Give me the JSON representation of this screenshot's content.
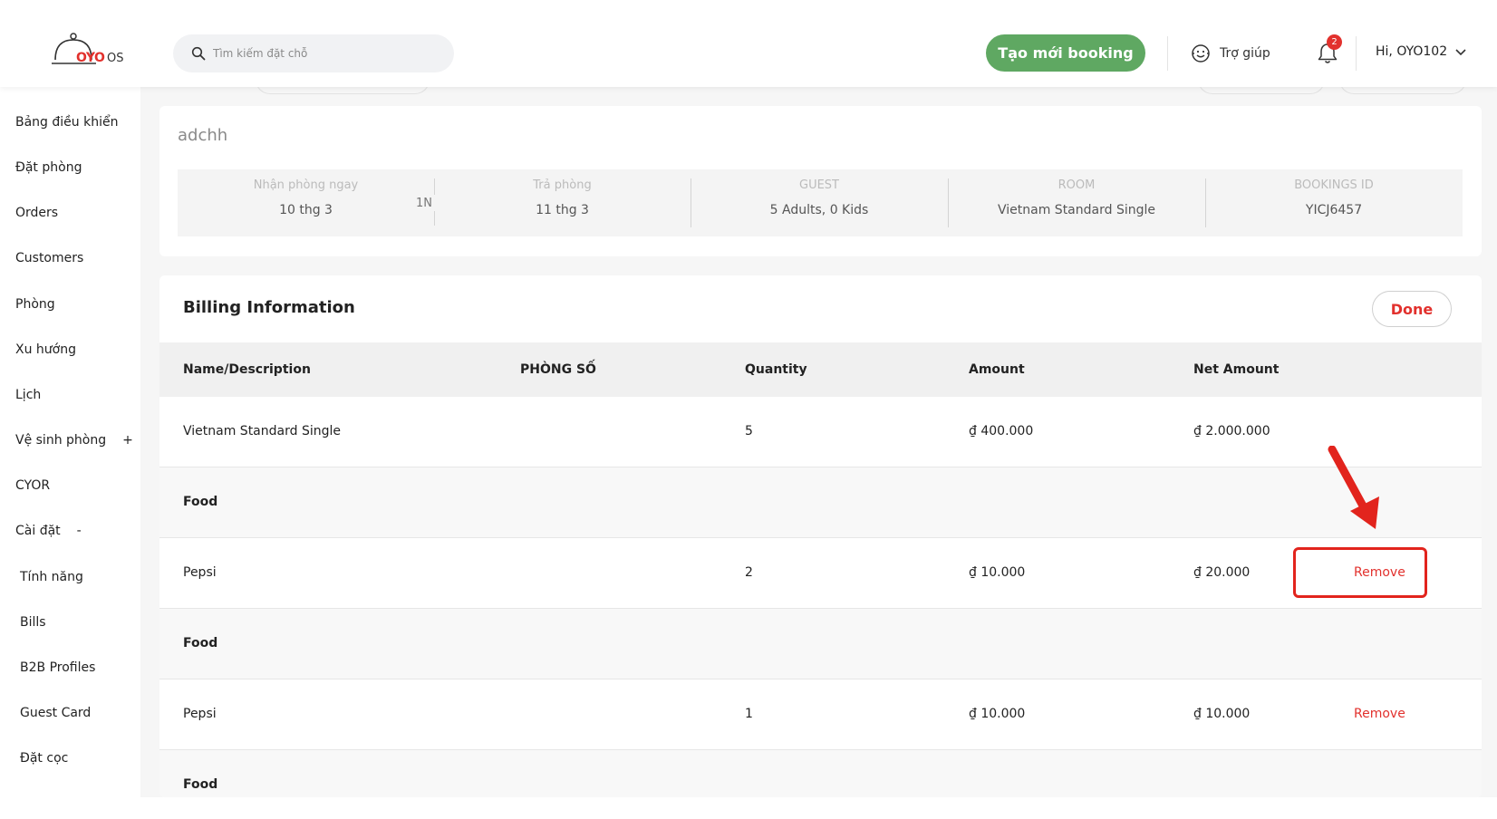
{
  "header": {
    "logo_text": "OYO",
    "logo_suffix": "OS",
    "search_placeholder": "Tìm kiếm đặt chỗ",
    "create_booking_label": "Tạo mới booking",
    "help_label": "Trợ giúp",
    "notification_count": "2",
    "user_greeting": "Hi, OYO102"
  },
  "sidebar": {
    "items": [
      {
        "label": "Bảng điều khiển"
      },
      {
        "label": "Đặt phòng"
      },
      {
        "label": "Orders"
      },
      {
        "label": "Customers"
      },
      {
        "label": "Phòng"
      },
      {
        "label": "Xu hướng"
      },
      {
        "label": "Lịch"
      },
      {
        "label": "Vệ sinh phòng",
        "toggle": "+"
      },
      {
        "label": "CYOR"
      },
      {
        "label": "Cài đặt",
        "toggle": "-"
      },
      {
        "label": "Tính năng"
      },
      {
        "label": "Bills"
      },
      {
        "label": "B2B Profiles"
      },
      {
        "label": "Guest Card"
      },
      {
        "label": "Đặt cọc"
      }
    ]
  },
  "booking": {
    "guest_name": "adchh",
    "checkin_label": "Nhận phòng ngay",
    "checkin_value": "10 thg 3",
    "nights": "1N",
    "checkout_label": "Trả phòng",
    "checkout_value": "11 thg 3",
    "guest_label": "GUEST",
    "guest_value": "5 Adults, 0 Kids",
    "room_label": "ROOM",
    "room_value": "Vietnam Standard Single",
    "booking_id_label": "BOOKINGS ID",
    "booking_id_value": "YICJ6457"
  },
  "billing": {
    "title": "Billing Information",
    "done_label": "Done",
    "columns": [
      "Name/Description",
      "PHÒNG SỐ",
      "Quantity",
      "Amount",
      "Net Amount"
    ],
    "rows": [
      {
        "name": "Vietnam Standard Single",
        "room": "",
        "qty": "5",
        "amount": "₫ 400.000",
        "net": "₫ 2.000.000",
        "action": ""
      },
      {
        "name": "Food",
        "room": "",
        "qty": "",
        "amount": "",
        "net": "",
        "action": ""
      },
      {
        "name": "Pepsi",
        "room": "",
        "qty": "2",
        "amount": "₫ 10.000",
        "net": "₫ 20.000",
        "action": "Remove"
      },
      {
        "name": "Food",
        "room": "",
        "qty": "",
        "amount": "",
        "net": "",
        "action": ""
      },
      {
        "name": "Pepsi",
        "room": "",
        "qty": "1",
        "amount": "₫ 10.000",
        "net": "₫ 10.000",
        "action": "Remove"
      },
      {
        "name": "Food",
        "room": "",
        "qty": "",
        "amount": "",
        "net": "",
        "action": ""
      }
    ]
  },
  "colors": {
    "brand_red": "#e2312d",
    "create_green": "#5fa862",
    "annotation_red": "#e2241d"
  },
  "icons": [
    "search-icon",
    "help-face-icon",
    "bell-icon",
    "chevron-down-icon",
    "red-arrow-annotation-icon"
  ]
}
